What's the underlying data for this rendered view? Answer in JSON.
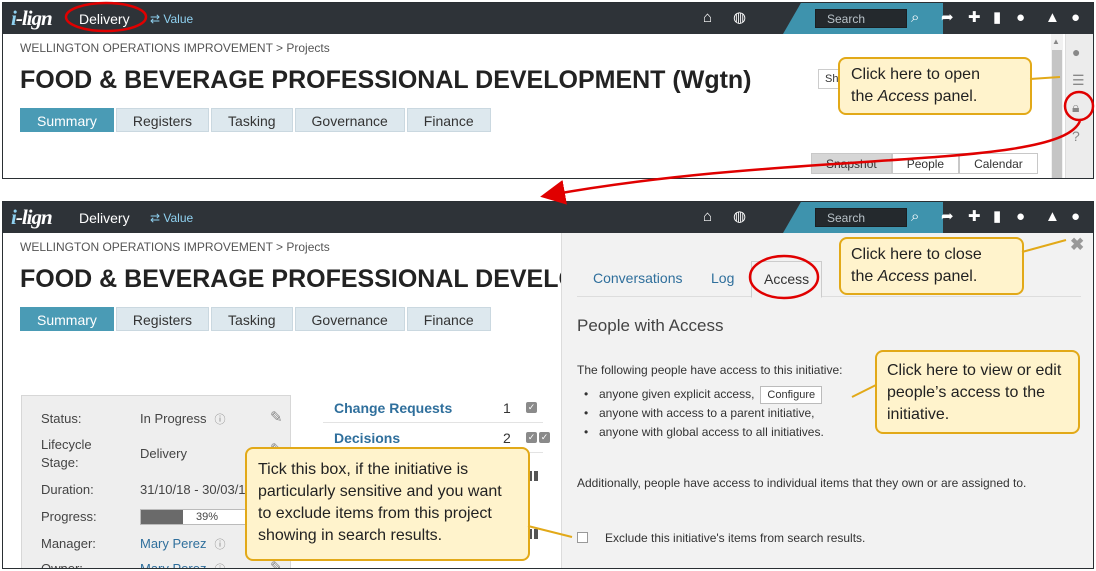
{
  "app": {
    "logo_text": "i-lign",
    "nav_delivery": "Delivery",
    "nav_value": "⇄ Value",
    "search_placeholder": "Search"
  },
  "page": {
    "breadcrumb": "WELLINGTON OPERATIONS IMPROVEMENT > Projects",
    "title": "FOOD & BEVERAGE PROFESSIONAL DEVELOPMENT (Wgtn)",
    "title_truncated": "FOOD & BEVERAGE PROFESSIONAL DEVELOI",
    "tabs": [
      "Summary",
      "Registers",
      "Tasking",
      "Governance",
      "Finance"
    ],
    "active_tab": "Summary",
    "view_buttons": [
      "Snapshot",
      "People",
      "Calendar"
    ],
    "active_view": "Snapshot",
    "hidden_combo_text": "Sho"
  },
  "summary": {
    "status_label": "Status:",
    "status_value": "In Progress",
    "lifecycle_label_1": "Lifecycle",
    "lifecycle_label_2": "Stage:",
    "lifecycle_value": "Delivery",
    "duration_label": "Duration:",
    "duration_value": "31/10/18 - 30/03/1",
    "progress_label": "Progress:",
    "progress_text": "39%",
    "progress_value": 0.39,
    "manager_label": "Manager:",
    "manager_value": "Mary Perez",
    "owner_label": "Owner:",
    "owner_value": "Mary Perez"
  },
  "registers": [
    {
      "name": "Change Requests",
      "count": "1"
    },
    {
      "name": "Decisions",
      "count": "2"
    }
  ],
  "access_panel": {
    "tabs": [
      "Conversations",
      "Log",
      "Access"
    ],
    "active_tab": "Access",
    "heading": "People with Access",
    "intro": "The following people have access to this initiative:",
    "bullets": [
      "anyone given explicit access,",
      "anyone with access to a parent initiative,",
      "anyone with global access to all initiatives."
    ],
    "configure_label": "Configure",
    "additional": "Additionally, people have access to individual items that they own or are assigned to.",
    "exclude_label": "Exclude this initiative's items from search results."
  },
  "callouts": {
    "open_line1": "Click here to open",
    "open_line2_pre": "the ",
    "open_line2_em": "Access",
    "open_line2_post": " panel.",
    "close_line1": "Click here to close",
    "close_line2_pre": "the ",
    "close_line2_em": "Access",
    "close_line2_post": " panel.",
    "configure_text": "Click here to view or edit people’s access to the initiative.",
    "exclude_text": "Tick this box, if the initiative is particularly sensitive and you want to exclude items from this project showing in search results."
  },
  "colors": {
    "topbar": "#2e3338",
    "accent_teal": "#3e93ad",
    "active_tab": "#4a9bb5",
    "callout_fill": "#fff3cc",
    "callout_border": "#e2a918",
    "annotation_red": "#e00000"
  },
  "icons": [
    "home-icon",
    "globe-icon",
    "search-icon",
    "share-icon",
    "plus-icon",
    "bookmark-icon",
    "chat-icon",
    "bell-icon",
    "user-icon",
    "comment-icon",
    "list-icon",
    "lock-icon",
    "help-icon",
    "close-icon",
    "info-icon",
    "pencil-icon"
  ]
}
